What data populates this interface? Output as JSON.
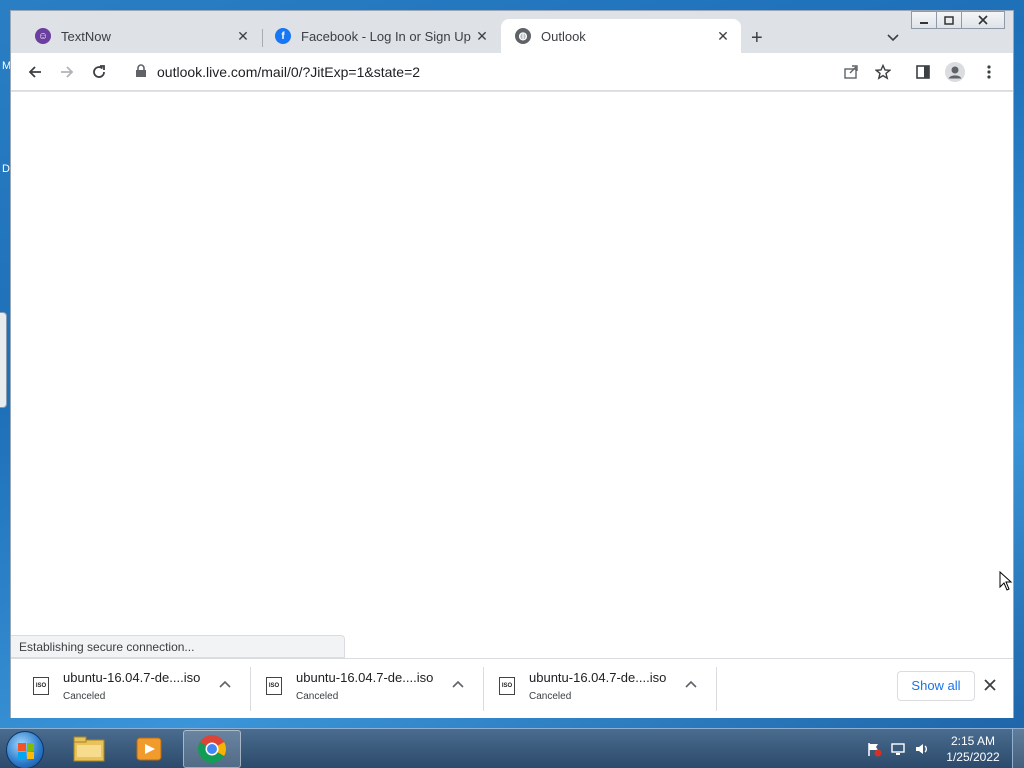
{
  "desktop": {
    "left_letter_top": "M",
    "left_letter_mid": "D"
  },
  "browser": {
    "tabs": [
      {
        "label": "TextNow",
        "favicon": "textnow-icon",
        "active": false
      },
      {
        "label": "Facebook - Log In or Sign Up",
        "favicon": "facebook-icon",
        "active": false
      },
      {
        "label": "Outlook",
        "favicon": "globe-icon",
        "active": true
      }
    ],
    "new_tab_label": "+",
    "url": "outlook.live.com/mail/0/?JitExp=1&state=2",
    "status_text": "Establishing secure connection..."
  },
  "downloads": {
    "items": [
      {
        "filename": "ubuntu-16.04.7-de....iso",
        "status": "Canceled",
        "icon_label": "ISO"
      },
      {
        "filename": "ubuntu-16.04.7-de....iso",
        "status": "Canceled",
        "icon_label": "ISO"
      },
      {
        "filename": "ubuntu-16.04.7-de....iso",
        "status": "Canceled",
        "icon_label": "ISO"
      }
    ],
    "show_all_label": "Show all"
  },
  "taskbar": {
    "time": "2:15 AM",
    "date": "1/25/2022"
  },
  "colors": {
    "accent": "#1a73e8",
    "textnow": "#6b3fa0",
    "facebook": "#1877f2"
  }
}
